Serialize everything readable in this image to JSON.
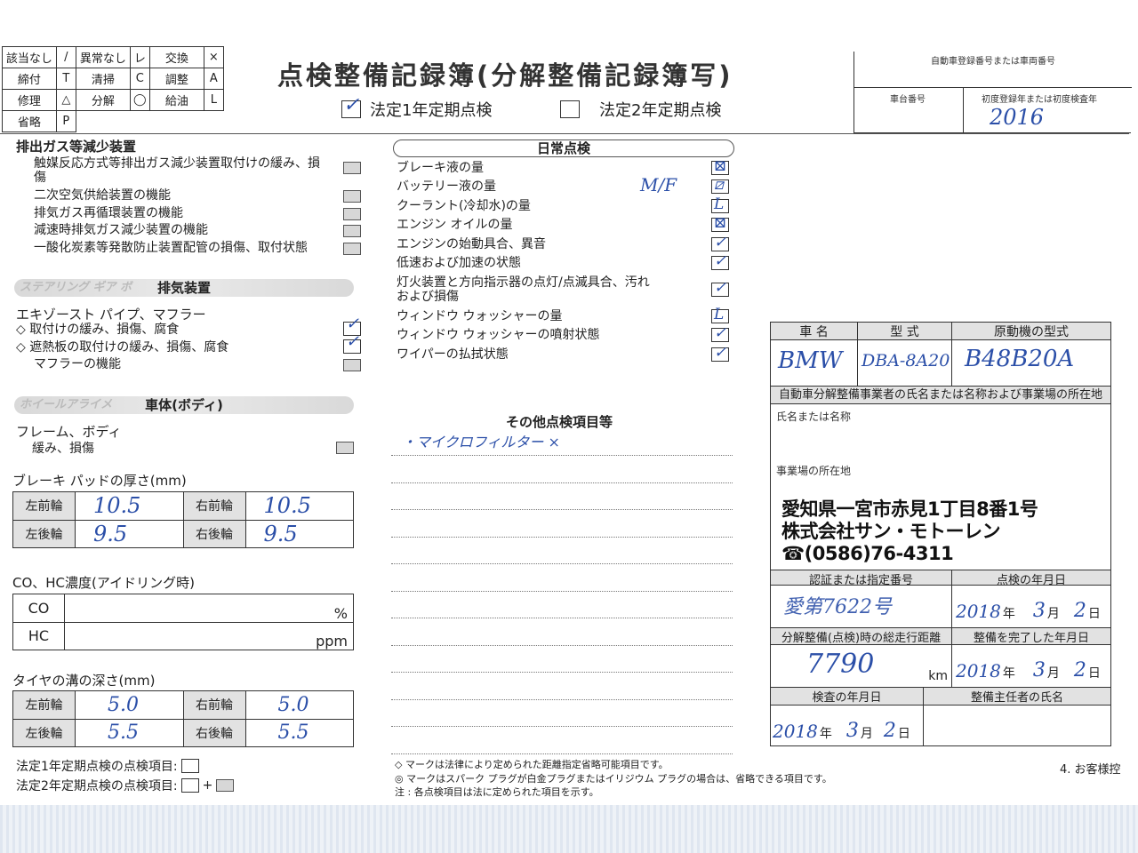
{
  "legend": {
    "rows": [
      [
        "該当なし",
        "/",
        "異常なし",
        "レ",
        "交換",
        "×"
      ],
      [
        "締付",
        "T",
        "清掃",
        "C",
        "調整",
        "A"
      ],
      [
        "修理",
        "△",
        "分解",
        "◯",
        "給油",
        "L"
      ],
      [
        "省略",
        "P",
        "",
        "",
        "",
        ""
      ]
    ]
  },
  "header": {
    "title": "点検整備記録簿(分解整備記録簿写)",
    "check1_label": "法定1年定期点検",
    "check1_checked": true,
    "check2_label": "法定2年定期点検",
    "check2_checked": false,
    "reg_label": "自動車登録番号または車両番号",
    "chassis_label": "車台番号",
    "first_reg_label": "初度登録年または初度検査年",
    "first_reg_value": "2016"
  },
  "exhaust_reduction": {
    "title": "排出ガス等減少装置",
    "items": [
      "触媒反応方式等排出ガス減少装置取付けの緩み、損傷",
      "二次空気供給装置の機能",
      "排気ガス再循環装置の機能",
      "減速時排気ガス減少装置の機能",
      "一酸化炭素等発散防止装置配管の損傷、取付状態"
    ]
  },
  "exhaust_system": {
    "faded_label": "ステアリング ギア ボ",
    "title": "排気装置",
    "subtitle": "エキゾースト パイプ、マフラー",
    "items": [
      {
        "label": "◇ 取付けの緩み、損傷、腐食",
        "mark": "✓"
      },
      {
        "label": "◇ 遮熱板の取付けの緩み、損傷、腐食",
        "mark": "✓"
      },
      {
        "label": "マフラーの機能",
        "mark": ""
      }
    ]
  },
  "body_section": {
    "faded_label": "ホイールアライメ",
    "title": "車体(ボディ)",
    "subtitle": "フレーム、ボディ",
    "item": "緩み、損傷"
  },
  "brake_pad": {
    "title": "ブレーキ パッドの厚さ(mm)",
    "fl_label": "左前輪",
    "fl_value": "10.5",
    "fr_label": "右前輪",
    "fr_value": "10.5",
    "rl_label": "左後輪",
    "rl_value": "9.5",
    "rr_label": "右後輪",
    "rr_value": "9.5"
  },
  "co_hc": {
    "title": "CO、HC濃度(アイドリング時)",
    "co_label": "CO",
    "co_unit": "%",
    "hc_label": "HC",
    "hc_unit": "ppm"
  },
  "tire": {
    "title": "タイヤの溝の深さ(mm)",
    "fl_label": "左前輪",
    "fl_value": "5.0",
    "fr_label": "右前輪",
    "fr_value": "5.0",
    "rl_label": "左後輪",
    "rl_value": "5.5",
    "rr_label": "右後輪",
    "rr_value": "5.5"
  },
  "footer_left": {
    "line1": "法定1年定期点検の点検項目:",
    "line2": "法定2年定期点検の点検項目:",
    "plus": "+"
  },
  "daily": {
    "title": "日常点検",
    "items": [
      {
        "label": "ブレーキ液の量",
        "mark": "⊠"
      },
      {
        "label": "バッテリー液の量",
        "mark": "⧄"
      },
      {
        "label": "クーラント(冷却水)の量",
        "mark": "L"
      },
      {
        "label": "エンジン オイルの量",
        "mark": "⊠"
      },
      {
        "label": "エンジンの始動具合、異音",
        "mark": "✓"
      },
      {
        "label": "低速および加速の状態",
        "mark": "✓"
      },
      {
        "label": "灯火装置と方向指示器の点灯/点滅具合、汚れおよび損傷",
        "mark": "✓"
      },
      {
        "label": "ウィンドウ ウォッシャーの量",
        "mark": "L"
      },
      {
        "label": "ウィンドウ ウォッシャーの噴射状態",
        "mark": "✓"
      },
      {
        "label": "ワイパーの払拭状態",
        "mark": "✓"
      }
    ],
    "battery_note": "M/F"
  },
  "other": {
    "title": "その他点検項目等",
    "entry": "・マイクロフィルター ×"
  },
  "vehicle": {
    "name_label": "車 名",
    "name_value": "BMW",
    "model_label": "型 式",
    "model_value": "DBA-8A20",
    "engine_label": "原動機の型式",
    "engine_value": "B48B20A",
    "shop_header": "自動車分解整備事業者の氏名または名称および事業場の所在地",
    "name_or_title": "氏名または名称",
    "location_label": "事業場の所在地",
    "stamp_line1": "愛知県一宮市赤見1丁目8番1号",
    "stamp_line2": "株式会社サン・モトーレン",
    "stamp_line3": "☎(0586)76-4311",
    "cert_label": "認証または指定番号",
    "cert_value": "愛第7622号",
    "inspect_date_label": "点検の年月日",
    "inspect_year": "2018",
    "inspect_month": "3",
    "inspect_day": "2",
    "odometer_label": "分解整備(点検)時の総走行距離",
    "odometer_value": "7790",
    "odometer_unit": "km",
    "complete_label": "整備を完了した年月日",
    "complete_year": "2018",
    "complete_month": "3",
    "complete_day": "2",
    "exam_label": "検査の年月日",
    "exam_year": "2018",
    "exam_month": "3",
    "exam_day": "2",
    "mechanic_label": "整備主任者の氏名",
    "year_char": "年",
    "month_char": "月",
    "day_char": "日"
  },
  "footnotes": {
    "n1": "◇ マークは法律により定められた距離指定省略可能項目です。",
    "n2": "◎ マークはスパーク プラグが白金プラグまたはイリジウム プラグの場合は、省略できる項目です。",
    "n3": "注 : 各点検項目は法に定められた項目を示す。",
    "right": "4. お客様控"
  }
}
